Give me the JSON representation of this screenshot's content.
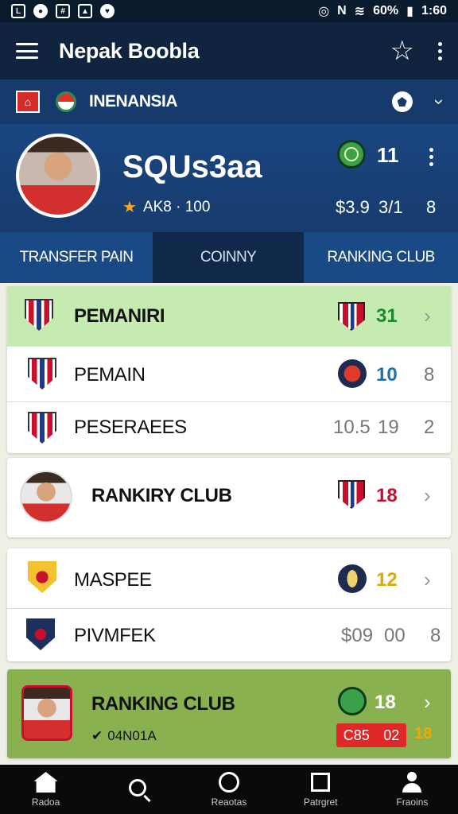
{
  "statusbar": {
    "battery": "60%",
    "time": "1:60"
  },
  "appbar": {
    "title": "Nepak Boobla"
  },
  "league": {
    "name": "INENANSIA"
  },
  "profile": {
    "name": "SQUs3aa",
    "subtitle": "AK8 · 100",
    "count": "11",
    "stat_a": "$3.9",
    "stat_b": "3/1",
    "stat_c": "8"
  },
  "tabs": [
    {
      "label": "TRANSFER PAIN"
    },
    {
      "label": "COINNY"
    },
    {
      "label": "RANKING CLUB"
    }
  ],
  "card1": {
    "rows": [
      {
        "label": "PEMANIRI",
        "value": "31",
        "value_color": "#1a8a2a"
      },
      {
        "label": "PEMAIN",
        "value": "10",
        "value_color": "#1f6fb2",
        "extra": "8"
      },
      {
        "label": "PESERAEES",
        "pre": "10.5",
        "value": "19",
        "extra": "2"
      }
    ]
  },
  "card2": {
    "label": "RANKIRY CLUB",
    "value": "18",
    "value_color": "#c8102e"
  },
  "card3": {
    "rows": [
      {
        "label": "MASPEE",
        "value": "12",
        "value_color": "#e0a800"
      },
      {
        "label": "PIVMFEK",
        "pre": "$09",
        "value": "00",
        "extra": "8"
      }
    ]
  },
  "card4": {
    "label": "RANKING CLUB",
    "sub": "04N01A",
    "value": "18",
    "tag_a": "C85",
    "tag_b": "02",
    "tag_c": "18"
  },
  "nav": [
    {
      "label": "Radoa",
      "icon": "home-icon"
    },
    {
      "label": "",
      "icon": "search-icon"
    },
    {
      "label": "Reaotas",
      "icon": "circle-icon"
    },
    {
      "label": "Patrgret",
      "icon": "square-icon"
    },
    {
      "label": "Fraoins",
      "icon": "profile-icon"
    }
  ],
  "colors": {
    "appbar": "#10243f",
    "league_bar": "#163a6b",
    "highlight_row": "#c6ebb0",
    "ranking_card": "#8ab14f"
  }
}
